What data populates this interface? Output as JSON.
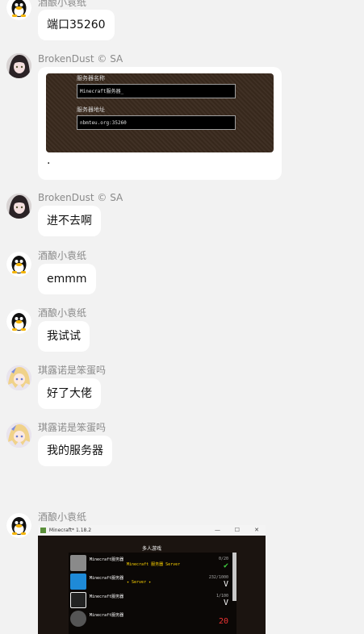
{
  "messages": [
    {
      "sender": "酒酿小袁纸",
      "text": "端口35260"
    },
    {
      "sender": "BrokenDust",
      "badge": "© SA",
      "caption": ".",
      "screenshot": {
        "label_name": "服务器名称",
        "field_name": "Minecraft服务器_",
        "label_addr": "服务器地址",
        "field_addr": "nbmteu.org:35260"
      }
    },
    {
      "sender": "BrokenDust",
      "badge": "© SA",
      "text": "进不去啊"
    },
    {
      "sender": "酒酿小袁纸",
      "text": "emmm"
    },
    {
      "sender": "酒酿小袁纸",
      "text": "我试试"
    },
    {
      "sender": "琪露诺是笨蛋吗",
      "text": "好了大佬"
    },
    {
      "sender": "琪露诺是笨蛋吗",
      "text": "我的服务器"
    },
    {
      "sender": "酒酿小袁纸",
      "screenshot": {
        "window_title": "Minecraft* 1.18.2",
        "heading": "多人游戏",
        "servers": [
          {
            "name": "Minecraft服务器",
            "motd": "Minecraft 服务器 Server",
            "count": "0/20",
            "mark": "✔"
          },
          {
            "name": "Minecraft服务器",
            "motd": "✦ Server ✦",
            "count": "232/1000",
            "mark": "V"
          },
          {
            "name": "Minecraft服务器",
            "motd": "",
            "count": "1/100",
            "mark": "V"
          },
          {
            "name": "Minecraft服务器",
            "motd": "",
            "count": "",
            "mark": "20"
          }
        ]
      }
    }
  ],
  "colors": {
    "page_bg": "#f2f2f2",
    "bubble_bg": "#ffffff",
    "name_text": "#8a8a8a"
  }
}
